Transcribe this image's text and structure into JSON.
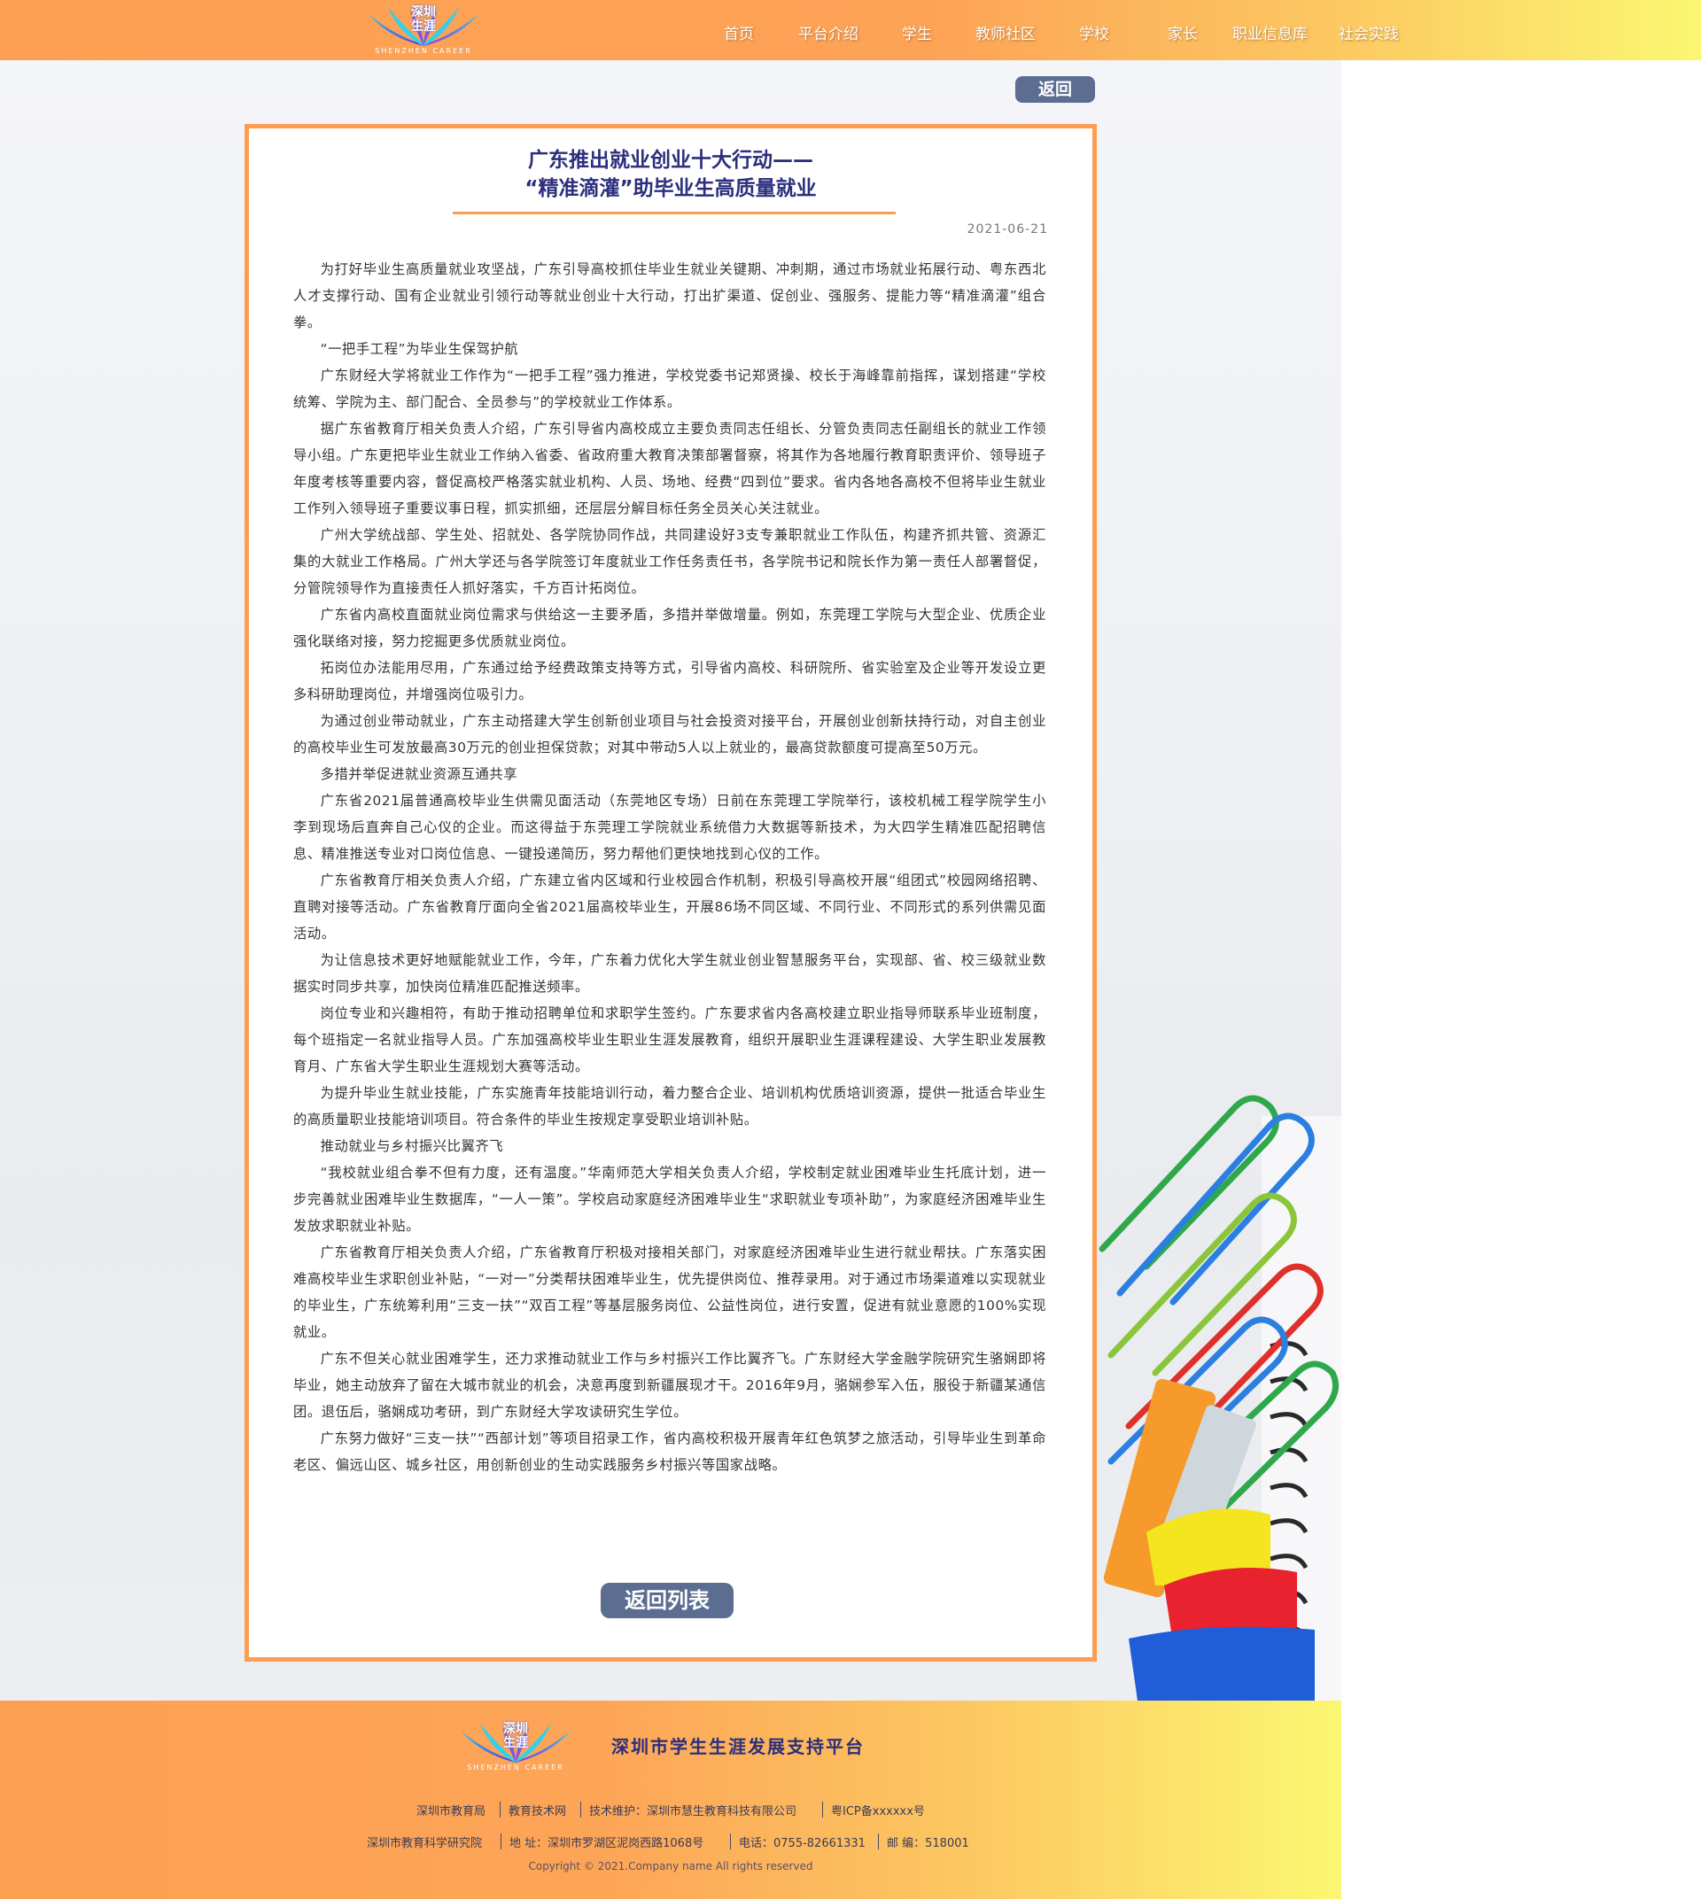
{
  "header": {
    "logo": {
      "text": "深圳\n生涯",
      "sub": "SHENZHEN CAREER"
    },
    "nav": [
      "首页",
      "平台介绍",
      "学生",
      "教师社区",
      "学校",
      "家长",
      "职业信息库",
      "社会实践"
    ]
  },
  "back_button": "返回",
  "article": {
    "title_line1": "广东推出就业创业十大行动——",
    "title_line2": "“精准滴灌”助毕业生高质量就业",
    "date": "2021-06-21",
    "paragraphs": [
      "为打好毕业生高质量就业攻坚战，广东引导高校抓住毕业生就业关键期、冲刺期，通过市场就业拓展行动、粤东西北人才支撑行动、国有企业就业引领行动等就业创业十大行动，打出扩渠道、促创业、强服务、提能力等“精准滴灌”组合拳。",
      "“一把手工程”为毕业生保驾护航",
      "广东财经大学将就业工作作为“一把手工程”强力推进，学校党委书记郑贤操、校长于海峰靠前指挥，谋划搭建“学校统筹、学院为主、部门配合、全员参与”的学校就业工作体系。",
      "据广东省教育厅相关负责人介绍，广东引导省内高校成立主要负责同志任组长、分管负责同志任副组长的就业工作领导小组。广东更把毕业生就业工作纳入省委、省政府重大教育决策部署督察，将其作为各地履行教育职责评价、领导班子年度考核等重要内容，督促高校严格落实就业机构、人员、场地、经费“四到位”要求。省内各地各高校不但将毕业生就业工作列入领导班子重要议事日程，抓实抓细，还层层分解目标任务全员关心关注就业。",
      "广州大学统战部、学生处、招就处、各学院协同作战，共同建设好3支专兼职就业工作队伍，构建齐抓共管、资源汇集的大就业工作格局。广州大学还与各学院签订年度就业工作任务责任书，各学院书记和院长作为第一责任人部署督促，分管院领导作为直接责任人抓好落实，千方百计拓岗位。",
      "广东省内高校直面就业岗位需求与供给这一主要矛盾，多措并举做增量。例如，东莞理工学院与大型企业、优质企业强化联络对接，努力挖掘更多优质就业岗位。",
      "拓岗位办法能用尽用，广东通过给予经费政策支持等方式，引导省内高校、科研院所、省实验室及企业等开发设立更多科研助理岗位，并增强岗位吸引力。",
      "为通过创业带动就业，广东主动搭建大学生创新创业项目与社会投资对接平台，开展创业创新扶持行动，对自主创业的高校毕业生可发放最高30万元的创业担保贷款；对其中带动5人以上就业的，最高贷款额度可提高至50万元。",
      "多措并举促进就业资源互通共享",
      "广东省2021届普通高校毕业生供需见面活动（东莞地区专场）日前在东莞理工学院举行，该校机械工程学院学生小李到现场后直奔自己心仪的企业。而这得益于东莞理工学院就业系统借力大数据等新技术，为大四学生精准匹配招聘信息、精准推送专业对口岗位信息、一键投递简历，努力帮他们更快地找到心仪的工作。",
      "广东省教育厅相关负责人介绍，广东建立省内区域和行业校园合作机制，积极引导高校开展“组团式”校园网络招聘、直聘对接等活动。广东省教育厅面向全省2021届高校毕业生，开展86场不同区域、不同行业、不同形式的系列供需见面活动。",
      "为让信息技术更好地赋能就业工作，今年，广东着力优化大学生就业创业智慧服务平台，实现部、省、校三级就业数据实时同步共享，加快岗位精准匹配推送频率。",
      "岗位专业和兴趣相符，有助于推动招聘单位和求职学生签约。广东要求省内各高校建立职业指导师联系毕业班制度，每个班指定一名就业指导人员。广东加强高校毕业生职业生涯发展教育，组织开展职业生涯课程建设、大学生职业发展教育月、广东省大学生职业生涯规划大赛等活动。",
      "为提升毕业生就业技能，广东实施青年技能培训行动，着力整合企业、培训机构优质培训资源，提供一批适合毕业生的高质量职业技能培训项目。符合条件的毕业生按规定享受职业培训补贴。",
      "推动就业与乡村振兴比翼齐飞",
      "“我校就业组合拳不但有力度，还有温度。”华南师范大学相关负责人介绍，学校制定就业困难毕业生托底计划，进一步完善就业困难毕业生数据库，“一人一策”。学校启动家庭经济困难毕业生“求职就业专项补助”，为家庭经济困难毕业生发放求职就业补贴。",
      "广东省教育厅相关负责人介绍，广东省教育厅积极对接相关部门，对家庭经济困难毕业生进行就业帮扶。广东落实困难高校毕业生求职创业补贴，“一对一”分类帮扶困难毕业生，优先提供岗位、推荐录用。对于通过市场渠道难以实现就业的毕业生，广东统筹利用“三支一扶”“双百工程”等基层服务岗位、公益性岗位，进行安置，促进有就业意愿的100%实现就业。",
      "广东不但关心就业困难学生，还力求推动就业工作与乡村振兴工作比翼齐飞。广东财经大学金融学院研究生骆娴即将毕业，她主动放弃了留在大城市就业的机会，决意再度到新疆展现才干。2016年9月，骆娴参军入伍，服役于新疆某通信团。退伍后，骆娴成功考研，到广东财经大学攻读研究生学位。",
      "广东努力做好“三支一扶”“西部计划”等项目招录工作，省内高校积极开展青年红色筑梦之旅活动，引导毕业生到革命老区、偏远山区、城乡社区，用创新创业的生动实践服务乡村振兴等国家战略。"
    ]
  },
  "list_button": "返回列表",
  "footer": {
    "logo": {
      "text": "深圳\n生涯",
      "sub": "SHENZHEN CAREER"
    },
    "platform": "深圳市学生生涯发展支持平台",
    "row1": [
      "深圳市教育局",
      "教育技术网",
      "技术维护：深圳市慧生教育科技有限公司",
      "粤ICP备xxxxxx号"
    ],
    "row2": [
      "深圳市教育科学研究院",
      "地  址：深圳市罗湖区泥岗西路1068号",
      "电话：0755-82661331",
      "邮  编：518001"
    ],
    "copyright": "Copyright © 2021.Company name All rights reserved"
  },
  "colors": {
    "accent": "#fd9d51",
    "title": "#2b2f7d",
    "button": "#5b6d91"
  },
  "icons": [
    "shenzhen-career-logo",
    "paperclip-decoration"
  ]
}
